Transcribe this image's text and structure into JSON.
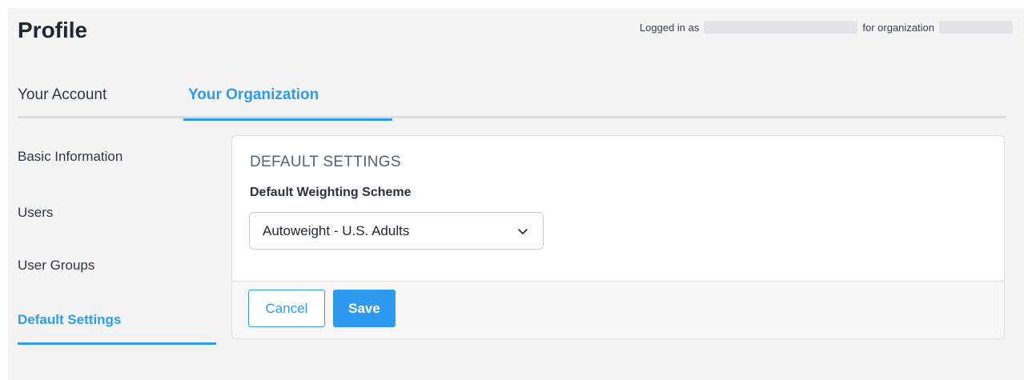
{
  "header": {
    "title": "Profile",
    "logged_in_prefix": "Logged in as",
    "org_prefix": "for organization"
  },
  "tabs": [
    {
      "label": "Your Account",
      "active": false
    },
    {
      "label": "Your Organization",
      "active": true
    }
  ],
  "sidebar": {
    "items": [
      {
        "label": "Basic Information",
        "active": false
      },
      {
        "label": "Users",
        "active": false
      },
      {
        "label": "User Groups",
        "active": false
      },
      {
        "label": "Default Settings",
        "active": true
      }
    ]
  },
  "card": {
    "heading": "DEFAULT SETTINGS",
    "field_label": "Default Weighting Scheme",
    "select_value": "Autoweight - U.S. Adults",
    "cancel_label": "Cancel",
    "save_label": "Save"
  },
  "colors": {
    "accent": "#2f9bf0",
    "background": "#f4f4f5",
    "card": "#ffffff"
  }
}
